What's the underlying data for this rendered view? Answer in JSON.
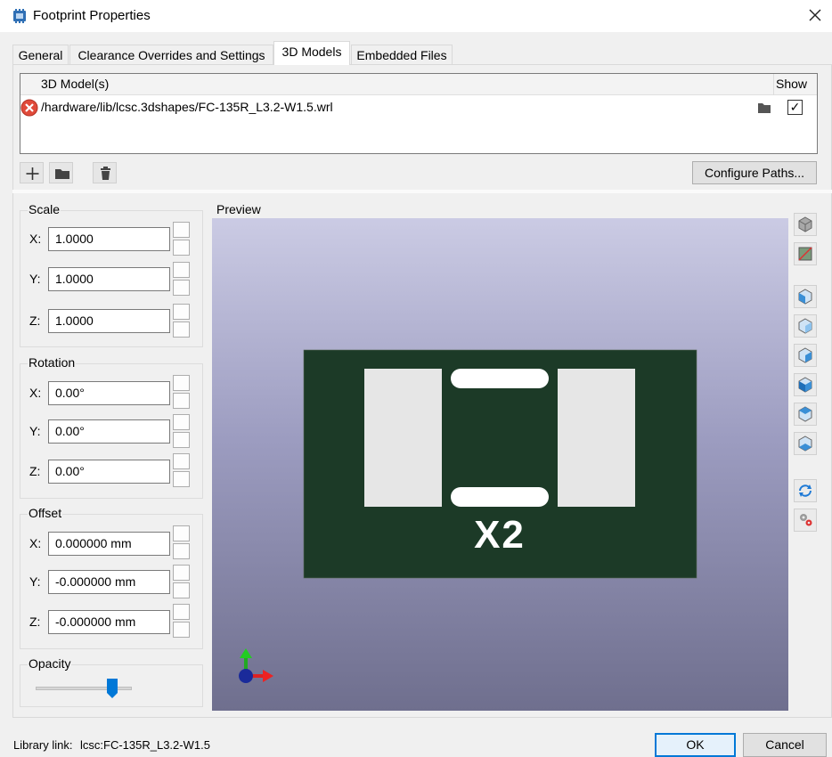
{
  "window": {
    "title": "Footprint Properties"
  },
  "tabs": [
    {
      "label": "General"
    },
    {
      "label": "Clearance Overrides and Settings"
    },
    {
      "label": "3D Models"
    },
    {
      "label": "Embedded Files"
    }
  ],
  "models_table": {
    "col_model": "3D Model(s)",
    "col_show": "Show",
    "rows": [
      {
        "path": "/hardware/lib/lcsc.3dshapes/FC-135R_L3.2-W1.5.wrl",
        "show": true,
        "status": "error"
      }
    ]
  },
  "buttons": {
    "configure_paths": "Configure Paths...",
    "ok": "OK",
    "cancel": "Cancel"
  },
  "scale": {
    "title": "Scale",
    "x_label": "X:",
    "y_label": "Y:",
    "z_label": "Z:",
    "x": "1.0000",
    "y": "1.0000",
    "z": "1.0000"
  },
  "rotation": {
    "title": "Rotation",
    "x_label": "X:",
    "y_label": "Y:",
    "z_label": "Z:",
    "x": "0.00°",
    "y": "0.00°",
    "z": "0.00°"
  },
  "offset": {
    "title": "Offset",
    "x_label": "X:",
    "y_label": "Y:",
    "z_label": "Z:",
    "x": "0.000000 mm",
    "y": "-0.000000 mm",
    "z": "-0.000000 mm"
  },
  "opacity": {
    "title": "Opacity",
    "value_fraction": 0.8
  },
  "preview": {
    "label": "Preview",
    "silkscreen_text": "X2"
  },
  "footer": {
    "library_link_label": "Library link:",
    "library_link_value": "lcsc:FC-135R_L3.2-W1.5"
  },
  "colors": {
    "pcb": "#1c3a27",
    "pad": "#e6e6e6",
    "accent": "#0078d7",
    "error": "#e04a3a"
  }
}
